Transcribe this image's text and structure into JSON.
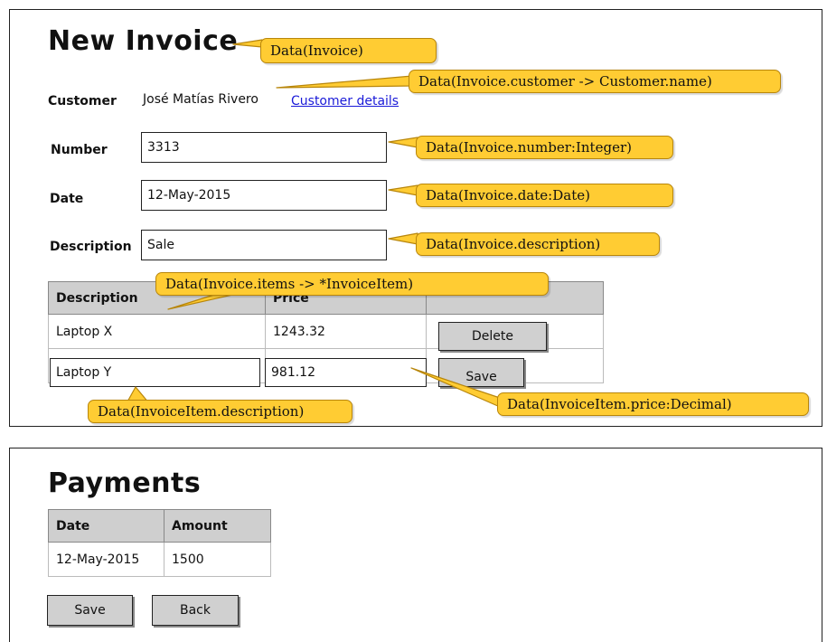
{
  "invoice": {
    "title": "New Invoice",
    "customer_label": "Customer",
    "customer_name": "José Matías Rivero",
    "customer_link": "Customer details",
    "number_label": "Number",
    "number_value": "3313",
    "date_label": "Date",
    "date_value": "12-May-2015",
    "description_label": "Description",
    "description_value": "Sale",
    "items_table": {
      "headers": [
        "Description",
        "Price",
        ""
      ],
      "rows": [
        {
          "description": "Laptop X",
          "price": "1243.32",
          "action": "Delete"
        },
        {
          "description": "Laptop Y",
          "price": "981.12",
          "action": "Save"
        }
      ]
    }
  },
  "payments": {
    "title": "Payments",
    "headers": [
      "Date",
      "Amount"
    ],
    "rows": [
      {
        "date": "12-May-2015",
        "amount": "1500"
      }
    ],
    "save_label": "Save",
    "back_label": "Back"
  },
  "annotations": {
    "invoice": "Data(Invoice)",
    "customer": "Data(Invoice.customer -> Customer.name)",
    "number": "Data(Invoice.number:Integer)",
    "date": "Data(Invoice.date:Date)",
    "description": "Data(Invoice.description)",
    "items": "Data(Invoice.items -> *InvoiceItem)",
    "item_description": "Data(InvoiceItem.description)",
    "item_price": "Data(InvoiceItem.price:Decimal)"
  },
  "colors": {
    "note_fill": "#ffcc33",
    "note_border": "#b8860b",
    "header_fill": "#cfcfcf",
    "button_fill": "#d0d0d0",
    "link": "#1a1ad8"
  }
}
